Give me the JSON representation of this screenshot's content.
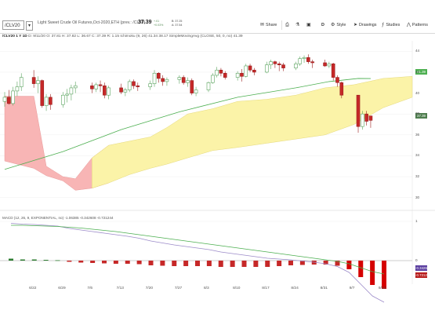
{
  "header": {
    "symbol": "/CLV20",
    "description": "Light Sweet Crude Oil Futures,Oct-2020,ETH (prev.: /CLX0)",
    "last": "37.39",
    "change": "+.01",
    "change_pct": "+0.03%",
    "bid": "B: 37.25",
    "ask": "A: 37.54"
  },
  "toolbar": {
    "share": "Share",
    "style": "Style",
    "drawings": "Drawings",
    "studies": "Studies",
    "patterns": "Patterns",
    "d_label": "D"
  },
  "chart_header": {
    "aggregation": "/CLV20 1 Y 1D",
    "ohlc": "D: 9/11/20  O: 37.81  H: 37.82  L: 36.67  C: 37.39  R: 1.15",
    "ichimoku": "Ichimoku (9, 26)  41.34  38.17",
    "sma": "SimpleMovingAvg (CLOSE, 50, 0, no)  41.39"
  },
  "macd_header": "MACD (12, 26, 9, EXPONENTIAL, no)  -1.06385  -0.342608  -0.721244",
  "price_labels": {
    "sma": "41.39",
    "close": "37.39",
    "macd_avg": "-0.34268",
    "macd_diff": "-0.7212"
  },
  "colors": {
    "up": "#6fbf73",
    "down": "#c62828",
    "cloud_bull": "#fbf3a8",
    "cloud_bear": "#f8b5b5",
    "sma": "#4caf50",
    "macd_value": "#9c8bc9",
    "macd_avg": "#4caf50"
  },
  "chart_data": {
    "type": "candlestick",
    "price_axis": {
      "ticks": [
        "44",
        "42",
        "40",
        "38",
        "36",
        "34",
        "32",
        "30"
      ],
      "ylim": [
        29,
        45
      ]
    },
    "x_labels": [
      "6/22",
      "6/29",
      "7/6",
      "7/13",
      "7/20",
      "7/27",
      "8/3",
      "8/10",
      "8/17",
      "8/24",
      "8/31",
      "9/7",
      "9/14"
    ],
    "macd_axis": {
      "ticks": [
        "1",
        "0"
      ]
    },
    "candles": [
      {
        "d": "6/15",
        "o": 39.2,
        "h": 40.1,
        "l": 38.7,
        "c": 39.6
      },
      {
        "d": "6/16",
        "o": 39.6,
        "h": 40.3,
        "l": 38.9,
        "c": 39.0
      },
      {
        "d": "6/17",
        "o": 39.0,
        "h": 40.6,
        "l": 38.8,
        "c": 40.2
      },
      {
        "d": "6/18",
        "o": 40.2,
        "h": 41.1,
        "l": 39.7,
        "c": 40.6
      },
      {
        "d": "6/19",
        "o": 40.6,
        "h": 41.9,
        "l": 40.2,
        "c": 41.5
      },
      {
        "d": "6/22",
        "o": 41.5,
        "h": 42.2,
        "l": 40.5,
        "c": 40.9
      },
      {
        "d": "6/23",
        "o": 40.9,
        "h": 41.6,
        "l": 40.0,
        "c": 41.2
      },
      {
        "d": "6/24",
        "o": 41.2,
        "h": 41.3,
        "l": 38.6,
        "c": 38.8
      },
      {
        "d": "6/25",
        "o": 38.8,
        "h": 39.9,
        "l": 38.3,
        "c": 39.6
      },
      {
        "d": "6/26",
        "o": 39.6,
        "h": 39.9,
        "l": 38.4,
        "c": 38.9
      },
      {
        "d": "6/29",
        "o": 38.9,
        "h": 40.1,
        "l": 38.6,
        "c": 39.8
      },
      {
        "d": "6/30",
        "o": 39.8,
        "h": 40.4,
        "l": 39.1,
        "c": 39.9
      },
      {
        "d": "7/1",
        "o": 39.9,
        "h": 40.8,
        "l": 39.3,
        "c": 40.5
      },
      {
        "d": "7/2",
        "o": 40.5,
        "h": 41.1,
        "l": 40.0,
        "c": 40.7
      },
      {
        "d": "7/6",
        "o": 40.7,
        "h": 41.0,
        "l": 40.0,
        "c": 40.4
      },
      {
        "d": "7/7",
        "o": 40.4,
        "h": 41.0,
        "l": 40.1,
        "c": 40.8
      },
      {
        "d": "7/8",
        "o": 40.8,
        "h": 41.2,
        "l": 40.1,
        "c": 40.7
      },
      {
        "d": "7/9",
        "o": 40.7,
        "h": 41.0,
        "l": 39.5,
        "c": 39.8
      },
      {
        "d": "7/10",
        "o": 39.8,
        "h": 40.7,
        "l": 39.4,
        "c": 40.5
      },
      {
        "d": "7/13",
        "o": 40.5,
        "h": 40.9,
        "l": 39.9,
        "c": 40.1
      },
      {
        "d": "7/14",
        "o": 40.1,
        "h": 40.5,
        "l": 39.7,
        "c": 40.3
      },
      {
        "d": "7/15",
        "o": 40.3,
        "h": 41.3,
        "l": 40.1,
        "c": 41.1
      },
      {
        "d": "7/16",
        "o": 41.1,
        "h": 41.3,
        "l": 40.4,
        "c": 40.7
      },
      {
        "d": "7/17",
        "o": 40.7,
        "h": 41.0,
        "l": 40.2,
        "c": 40.6
      },
      {
        "d": "7/20",
        "o": 40.6,
        "h": 41.2,
        "l": 40.3,
        "c": 40.9
      },
      {
        "d": "7/21",
        "o": 40.9,
        "h": 42.2,
        "l": 40.6,
        "c": 41.9
      },
      {
        "d": "7/22",
        "o": 41.9,
        "h": 42.0,
        "l": 41.0,
        "c": 41.4
      },
      {
        "d": "7/23",
        "o": 41.4,
        "h": 41.7,
        "l": 40.7,
        "c": 41.1
      },
      {
        "d": "7/24",
        "o": 41.1,
        "h": 41.5,
        "l": 40.7,
        "c": 41.3
      },
      {
        "d": "7/27",
        "o": 41.3,
        "h": 41.7,
        "l": 40.9,
        "c": 41.5
      },
      {
        "d": "7/28",
        "o": 41.5,
        "h": 41.7,
        "l": 40.8,
        "c": 41.0
      },
      {
        "d": "7/29",
        "o": 41.0,
        "h": 41.5,
        "l": 40.6,
        "c": 41.2
      },
      {
        "d": "7/30",
        "o": 41.2,
        "h": 41.4,
        "l": 39.8,
        "c": 40.0
      },
      {
        "d": "7/31",
        "o": 40.0,
        "h": 40.6,
        "l": 39.7,
        "c": 40.3
      },
      {
        "d": "8/3",
        "o": 40.3,
        "h": 41.1,
        "l": 40.1,
        "c": 41.0
      },
      {
        "d": "8/4",
        "o": 41.0,
        "h": 41.9,
        "l": 40.9,
        "c": 41.7
      },
      {
        "d": "8/5",
        "o": 41.7,
        "h": 42.5,
        "l": 41.5,
        "c": 42.2
      },
      {
        "d": "8/6",
        "o": 42.2,
        "h": 42.4,
        "l": 41.6,
        "c": 41.9
      },
      {
        "d": "8/7",
        "o": 41.9,
        "h": 42.1,
        "l": 41.3,
        "c": 41.5
      },
      {
        "d": "8/10",
        "o": 41.5,
        "h": 42.1,
        "l": 41.2,
        "c": 41.9
      },
      {
        "d": "8/11",
        "o": 41.9,
        "h": 42.3,
        "l": 41.1,
        "c": 41.6
      },
      {
        "d": "8/12",
        "o": 41.6,
        "h": 42.8,
        "l": 41.5,
        "c": 42.6
      },
      {
        "d": "8/13",
        "o": 42.6,
        "h": 42.8,
        "l": 42.0,
        "c": 42.2
      },
      {
        "d": "8/14",
        "o": 42.2,
        "h": 42.4,
        "l": 41.7,
        "c": 42.0
      },
      {
        "d": "8/17",
        "o": 42.0,
        "h": 43.0,
        "l": 41.9,
        "c": 42.7
      },
      {
        "d": "8/18",
        "o": 42.7,
        "h": 43.2,
        "l": 42.3,
        "c": 43.0
      },
      {
        "d": "8/19",
        "o": 43.0,
        "h": 43.1,
        "l": 42.4,
        "c": 42.8
      },
      {
        "d": "8/20",
        "o": 42.8,
        "h": 43.0,
        "l": 42.1,
        "c": 42.7
      },
      {
        "d": "8/21",
        "o": 42.7,
        "h": 42.9,
        "l": 42.1,
        "c": 42.4
      },
      {
        "d": "8/24",
        "o": 42.4,
        "h": 43.0,
        "l": 42.2,
        "c": 42.8
      },
      {
        "d": "8/25",
        "o": 42.8,
        "h": 43.5,
        "l": 42.6,
        "c": 43.3
      },
      {
        "d": "8/26",
        "o": 43.3,
        "h": 43.6,
        "l": 42.9,
        "c": 43.4
      },
      {
        "d": "8/27",
        "o": 43.4,
        "h": 43.7,
        "l": 42.8,
        "c": 43.0
      },
      {
        "d": "8/28",
        "o": 43.0,
        "h": 43.2,
        "l": 42.4,
        "c": 42.9
      },
      {
        "d": "8/31",
        "o": 42.9,
        "h": 43.2,
        "l": 42.5,
        "c": 42.6
      },
      {
        "d": "9/1",
        "o": 42.6,
        "h": 43.0,
        "l": 42.4,
        "c": 42.8
      },
      {
        "d": "9/2",
        "o": 42.8,
        "h": 42.9,
        "l": 41.2,
        "c": 41.5
      },
      {
        "d": "9/3",
        "o": 41.5,
        "h": 41.7,
        "l": 40.6,
        "c": 41.0
      },
      {
        "d": "9/4",
        "o": 41.0,
        "h": 41.1,
        "l": 39.5,
        "c": 39.8
      },
      {
        "d": "9/8",
        "o": 39.8,
        "h": 39.8,
        "l": 36.2,
        "c": 36.8
      },
      {
        "d": "9/9",
        "o": 36.8,
        "h": 38.3,
        "l": 36.5,
        "c": 38.0
      },
      {
        "d": "9/10",
        "o": 38.0,
        "h": 38.3,
        "l": 36.9,
        "c": 37.3
      },
      {
        "d": "9/11",
        "o": 37.81,
        "h": 37.82,
        "l": 36.67,
        "c": 37.39
      }
    ],
    "sma50": [
      {
        "d": "6/15",
        "v": 32.7
      },
      {
        "d": "6/29",
        "v": 34.4
      },
      {
        "d": "7/13",
        "v": 36.5
      },
      {
        "d": "7/27",
        "v": 38.2
      },
      {
        "d": "8/10",
        "v": 39.6
      },
      {
        "d": "8/24",
        "v": 40.5
      },
      {
        "d": "9/1",
        "v": 41.1
      },
      {
        "d": "9/8",
        "v": 41.4
      },
      {
        "d": "9/11",
        "v": 41.39
      }
    ],
    "cloud_edges": {
      "upper": [
        {
          "d": "6/15",
          "v": 39.7
        },
        {
          "d": "6/22",
          "v": 39.7
        },
        {
          "d": "6/25",
          "v": 33.0
        },
        {
          "d": "6/29",
          "v": 32.0
        },
        {
          "d": "7/2",
          "v": 31.8
        },
        {
          "d": "7/6",
          "v": 33.8
        },
        {
          "d": "7/10",
          "v": 35.0
        },
        {
          "d": "7/15",
          "v": 35.4
        },
        {
          "d": "7/20",
          "v": 35.8
        },
        {
          "d": "7/24",
          "v": 36.7
        },
        {
          "d": "7/29",
          "v": 38.0
        },
        {
          "d": "8/4",
          "v": 38.5
        },
        {
          "d": "8/10",
          "v": 39.2
        },
        {
          "d": "8/17",
          "v": 39.4
        },
        {
          "d": "8/24",
          "v": 39.8
        },
        {
          "d": "8/31",
          "v": 40.5
        },
        {
          "d": "9/7",
          "v": 40.8
        },
        {
          "d": "9/14",
          "v": 41.4
        },
        {
          "d": "9/21",
          "v": 41.6
        }
      ],
      "lower": [
        {
          "d": "6/15",
          "v": 33.5
        },
        {
          "d": "6/22",
          "v": 32.8
        },
        {
          "d": "6/25",
          "v": 32.1
        },
        {
          "d": "6/29",
          "v": 31.6
        },
        {
          "d": "7/2",
          "v": 30.7
        },
        {
          "d": "7/6",
          "v": 30.9
        },
        {
          "d": "7/10",
          "v": 31.4
        },
        {
          "d": "7/15",
          "v": 32.2
        },
        {
          "d": "7/20",
          "v": 32.8
        },
        {
          "d": "7/24",
          "v": 33.2
        },
        {
          "d": "7/29",
          "v": 33.8
        },
        {
          "d": "8/4",
          "v": 34.5
        },
        {
          "d": "8/10",
          "v": 34.8
        },
        {
          "d": "8/17",
          "v": 35.2
        },
        {
          "d": "8/24",
          "v": 35.6
        },
        {
          "d": "8/31",
          "v": 36.0
        },
        {
          "d": "9/7",
          "v": 37.0
        },
        {
          "d": "9/14",
          "v": 38.6
        },
        {
          "d": "9/21",
          "v": 39.6
        }
      ]
    },
    "macd": {
      "value": [
        0.95,
        0.93,
        0.92,
        0.9,
        0.88,
        0.82,
        0.78,
        0.74,
        0.7,
        0.66,
        0.62,
        0.57,
        0.5,
        0.45,
        0.4,
        0.36,
        0.32,
        0.28,
        0.22,
        0.18,
        0.14,
        0.1,
        0.06,
        0.04,
        0.02,
        -0.01,
        -0.04,
        -0.08,
        -0.15,
        -0.3,
        -0.6,
        -0.9,
        -1.06
      ],
      "avg": [
        0.9,
        0.9,
        0.89,
        0.88,
        0.87,
        0.85,
        0.83,
        0.8,
        0.77,
        0.74,
        0.7,
        0.66,
        0.62,
        0.58,
        0.54,
        0.5,
        0.46,
        0.42,
        0.38,
        0.34,
        0.3,
        0.26,
        0.22,
        0.18,
        0.14,
        0.1,
        0.06,
        0.02,
        -0.02,
        -0.08,
        -0.18,
        -0.28,
        -0.34
      ],
      "diff": [
        0.05,
        0.03,
        0.03,
        0.02,
        0.01,
        -0.03,
        -0.05,
        -0.06,
        -0.07,
        -0.08,
        -0.08,
        -0.09,
        -0.12,
        -0.13,
        -0.14,
        -0.14,
        -0.14,
        -0.14,
        -0.16,
        -0.16,
        -0.16,
        -0.16,
        -0.16,
        -0.14,
        -0.12,
        -0.11,
        -0.1,
        -0.1,
        -0.13,
        -0.22,
        -0.42,
        -0.62,
        -0.72
      ]
    }
  }
}
